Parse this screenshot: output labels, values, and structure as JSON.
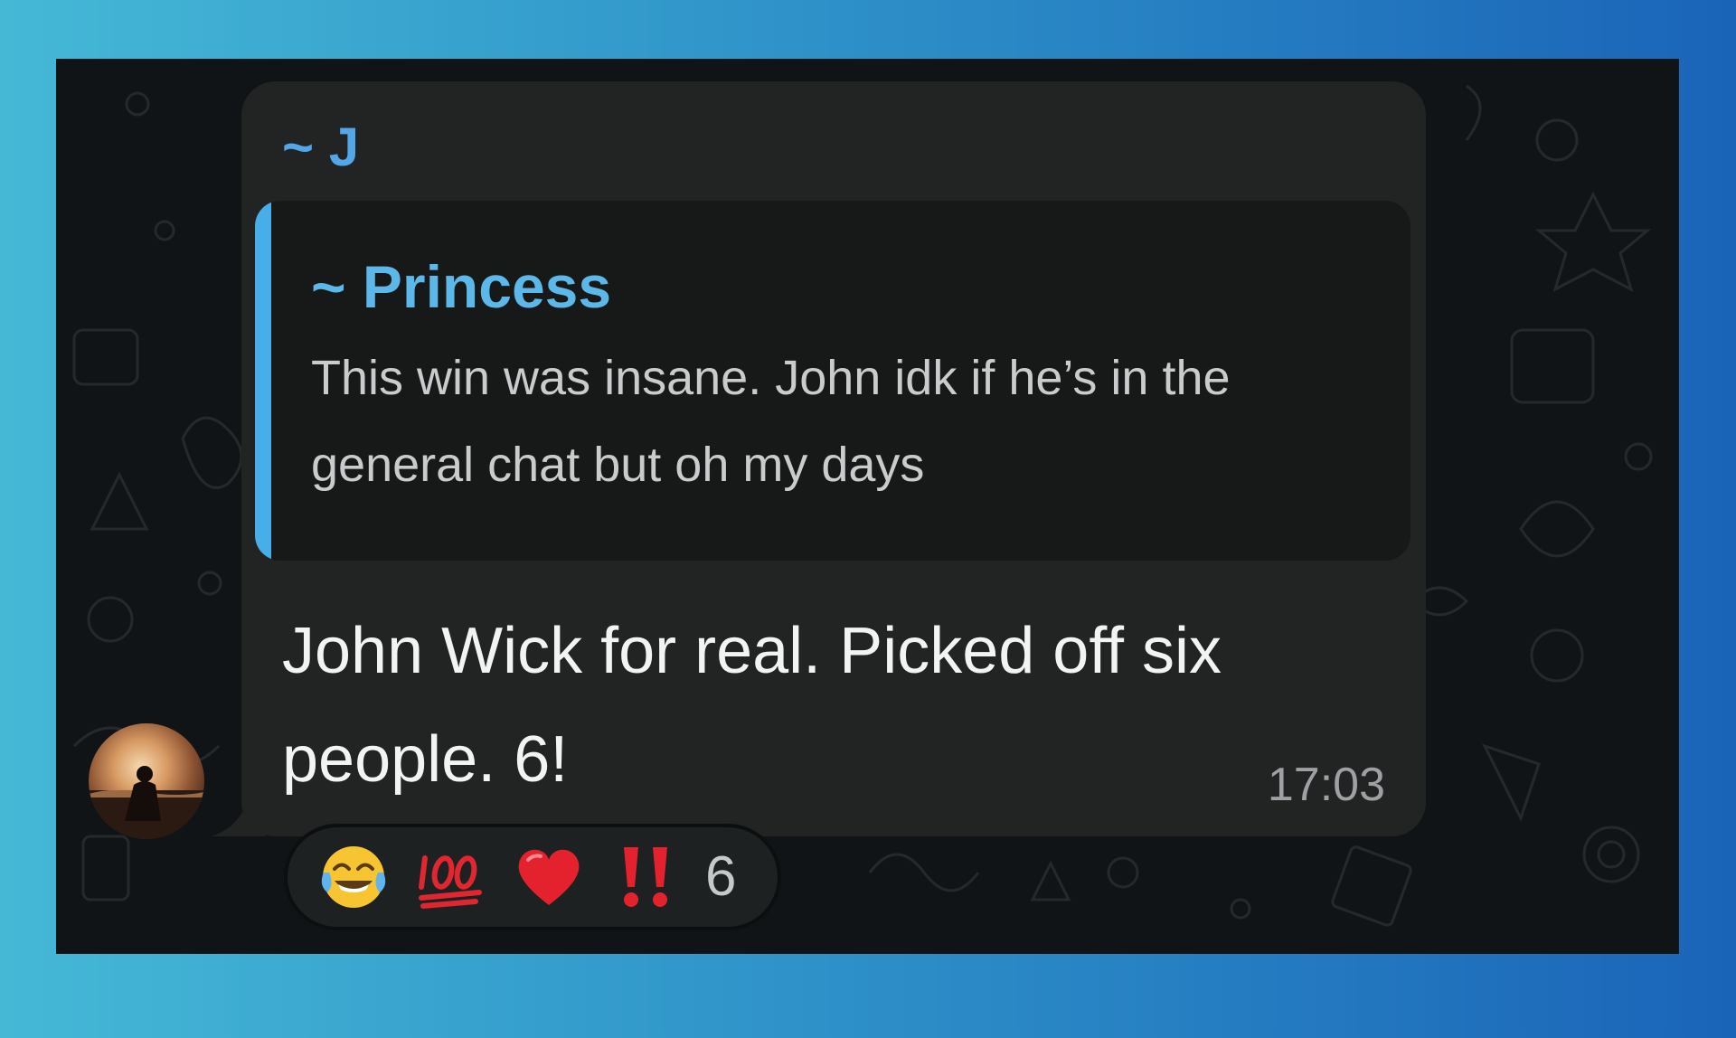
{
  "message": {
    "sender": "~ J",
    "reply": {
      "author": "~ Princess",
      "text": "This win was insane. John idk if he’s in the general chat but oh my days"
    },
    "text": "John Wick for real. Picked off six people. 6!",
    "time": "17:03"
  },
  "reactions": {
    "items": [
      {
        "name": "face-with-tears-of-joy",
        "glyph": "😂"
      },
      {
        "name": "hundred-points",
        "glyph": "💯"
      },
      {
        "name": "red-heart",
        "glyph": "❤️"
      },
      {
        "name": "double-exclamation",
        "glyph": "‼️"
      }
    ],
    "count": "6"
  },
  "colors": {
    "sender": "#53a6e8",
    "reply_bar": "#48aee8",
    "bubble": "#222424",
    "frame": "#111417"
  }
}
